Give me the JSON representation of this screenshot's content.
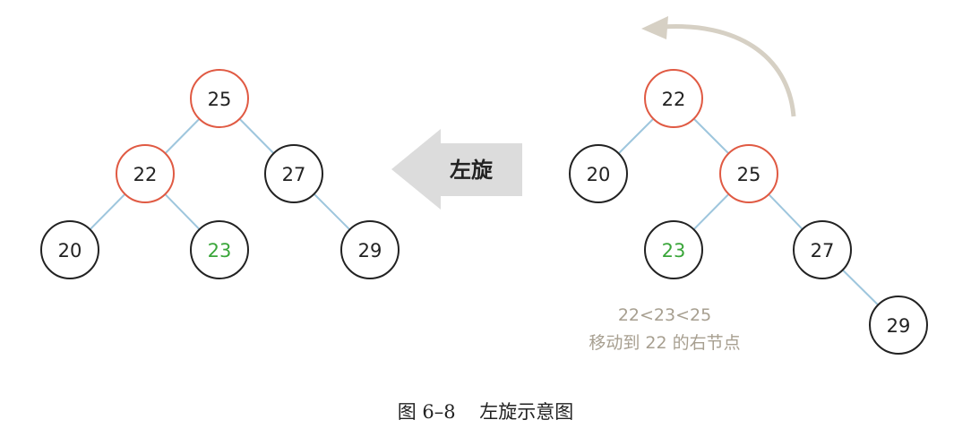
{
  "colors": {
    "edge": "#9ec6dd",
    "rotated_node_border": "#e05a43",
    "normal_node_border": "#222222",
    "text": "#222222",
    "moved_node_text": "#3aa63a",
    "note_text": "#a79f90",
    "arrow_fill": "#dcdcdc",
    "curved_arrow": "#d6d0c4"
  },
  "before_tree": {
    "nodes": [
      {
        "id": "b22",
        "label": "22",
        "style": "rotated"
      },
      {
        "id": "b20",
        "label": "20",
        "style": "normal"
      },
      {
        "id": "b25",
        "label": "25",
        "style": "rotated"
      },
      {
        "id": "b23",
        "label": "23",
        "style": "moved"
      },
      {
        "id": "b27",
        "label": "27",
        "style": "normal"
      },
      {
        "id": "b29",
        "label": "29",
        "style": "normal"
      }
    ],
    "edges": [
      [
        "b22",
        "b20"
      ],
      [
        "b22",
        "b25"
      ],
      [
        "b25",
        "b23"
      ],
      [
        "b25",
        "b27"
      ],
      [
        "b27",
        "b29"
      ]
    ]
  },
  "after_tree": {
    "nodes": [
      {
        "id": "a25",
        "label": "25",
        "style": "rotated"
      },
      {
        "id": "a22",
        "label": "22",
        "style": "rotated"
      },
      {
        "id": "a27",
        "label": "27",
        "style": "normal"
      },
      {
        "id": "a20",
        "label": "20",
        "style": "normal"
      },
      {
        "id": "a23",
        "label": "23",
        "style": "moved"
      },
      {
        "id": "a29",
        "label": "29",
        "style": "normal"
      }
    ],
    "edges": [
      [
        "a25",
        "a22"
      ],
      [
        "a25",
        "a27"
      ],
      [
        "a22",
        "a20"
      ],
      [
        "a22",
        "a23"
      ],
      [
        "a27",
        "a29"
      ]
    ]
  },
  "arrow_label": "左旋",
  "note": {
    "line1": "22<23<25",
    "line2": "移动到 22 的右节点"
  },
  "caption": {
    "figure_number": "图 6–8",
    "title": "左旋示意图"
  }
}
